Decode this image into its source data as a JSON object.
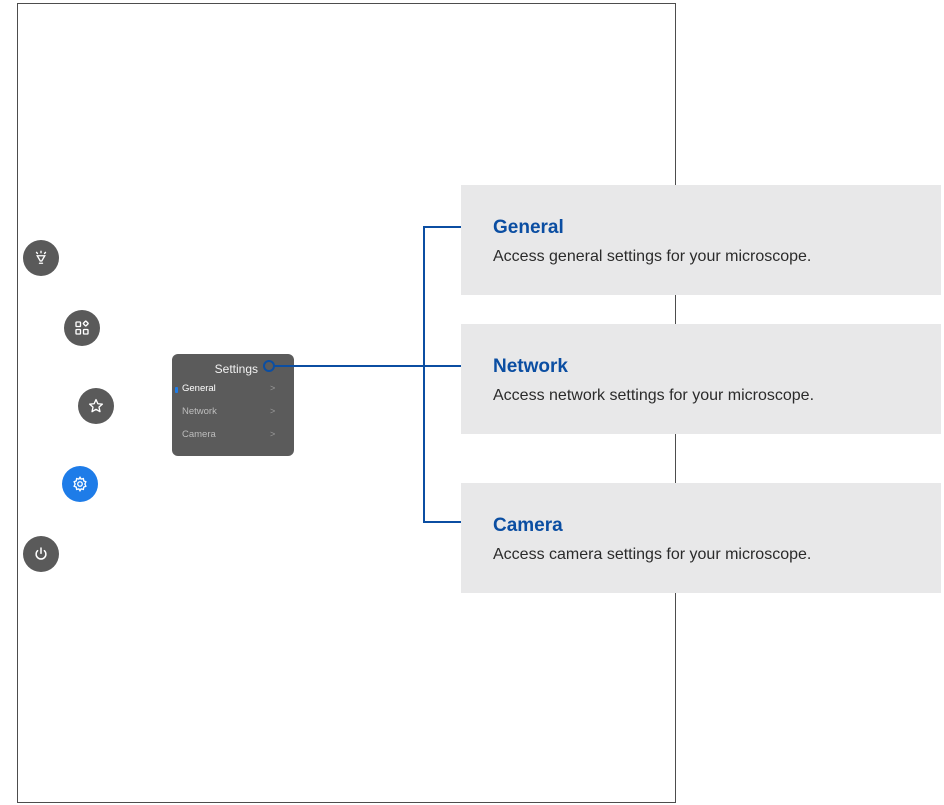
{
  "menu": {
    "title": "Settings",
    "items": [
      {
        "label": "General",
        "chevron": ">"
      },
      {
        "label": "Network",
        "chevron": ">"
      },
      {
        "label": "Camera",
        "chevron": ">"
      }
    ]
  },
  "side_buttons": [
    {
      "icon": "lightbulb-icon",
      "active": false
    },
    {
      "icon": "apps-icon",
      "active": false
    },
    {
      "icon": "star-icon",
      "active": false
    },
    {
      "icon": "gear-icon",
      "active": true
    },
    {
      "icon": "power-icon",
      "active": false
    }
  ],
  "callouts": [
    {
      "title": "General",
      "desc": "Access general settings for your microscope."
    },
    {
      "title": "Network",
      "desc": "Access network settings for your microscope."
    },
    {
      "title": "Camera",
      "desc": "Access camera settings for your microscope."
    }
  ],
  "colors": {
    "accent": "#1e7ce8",
    "callout_title": "#0b4ea2",
    "callout_bg": "#e8e8e9",
    "button_bg": "#5a5a5a"
  }
}
